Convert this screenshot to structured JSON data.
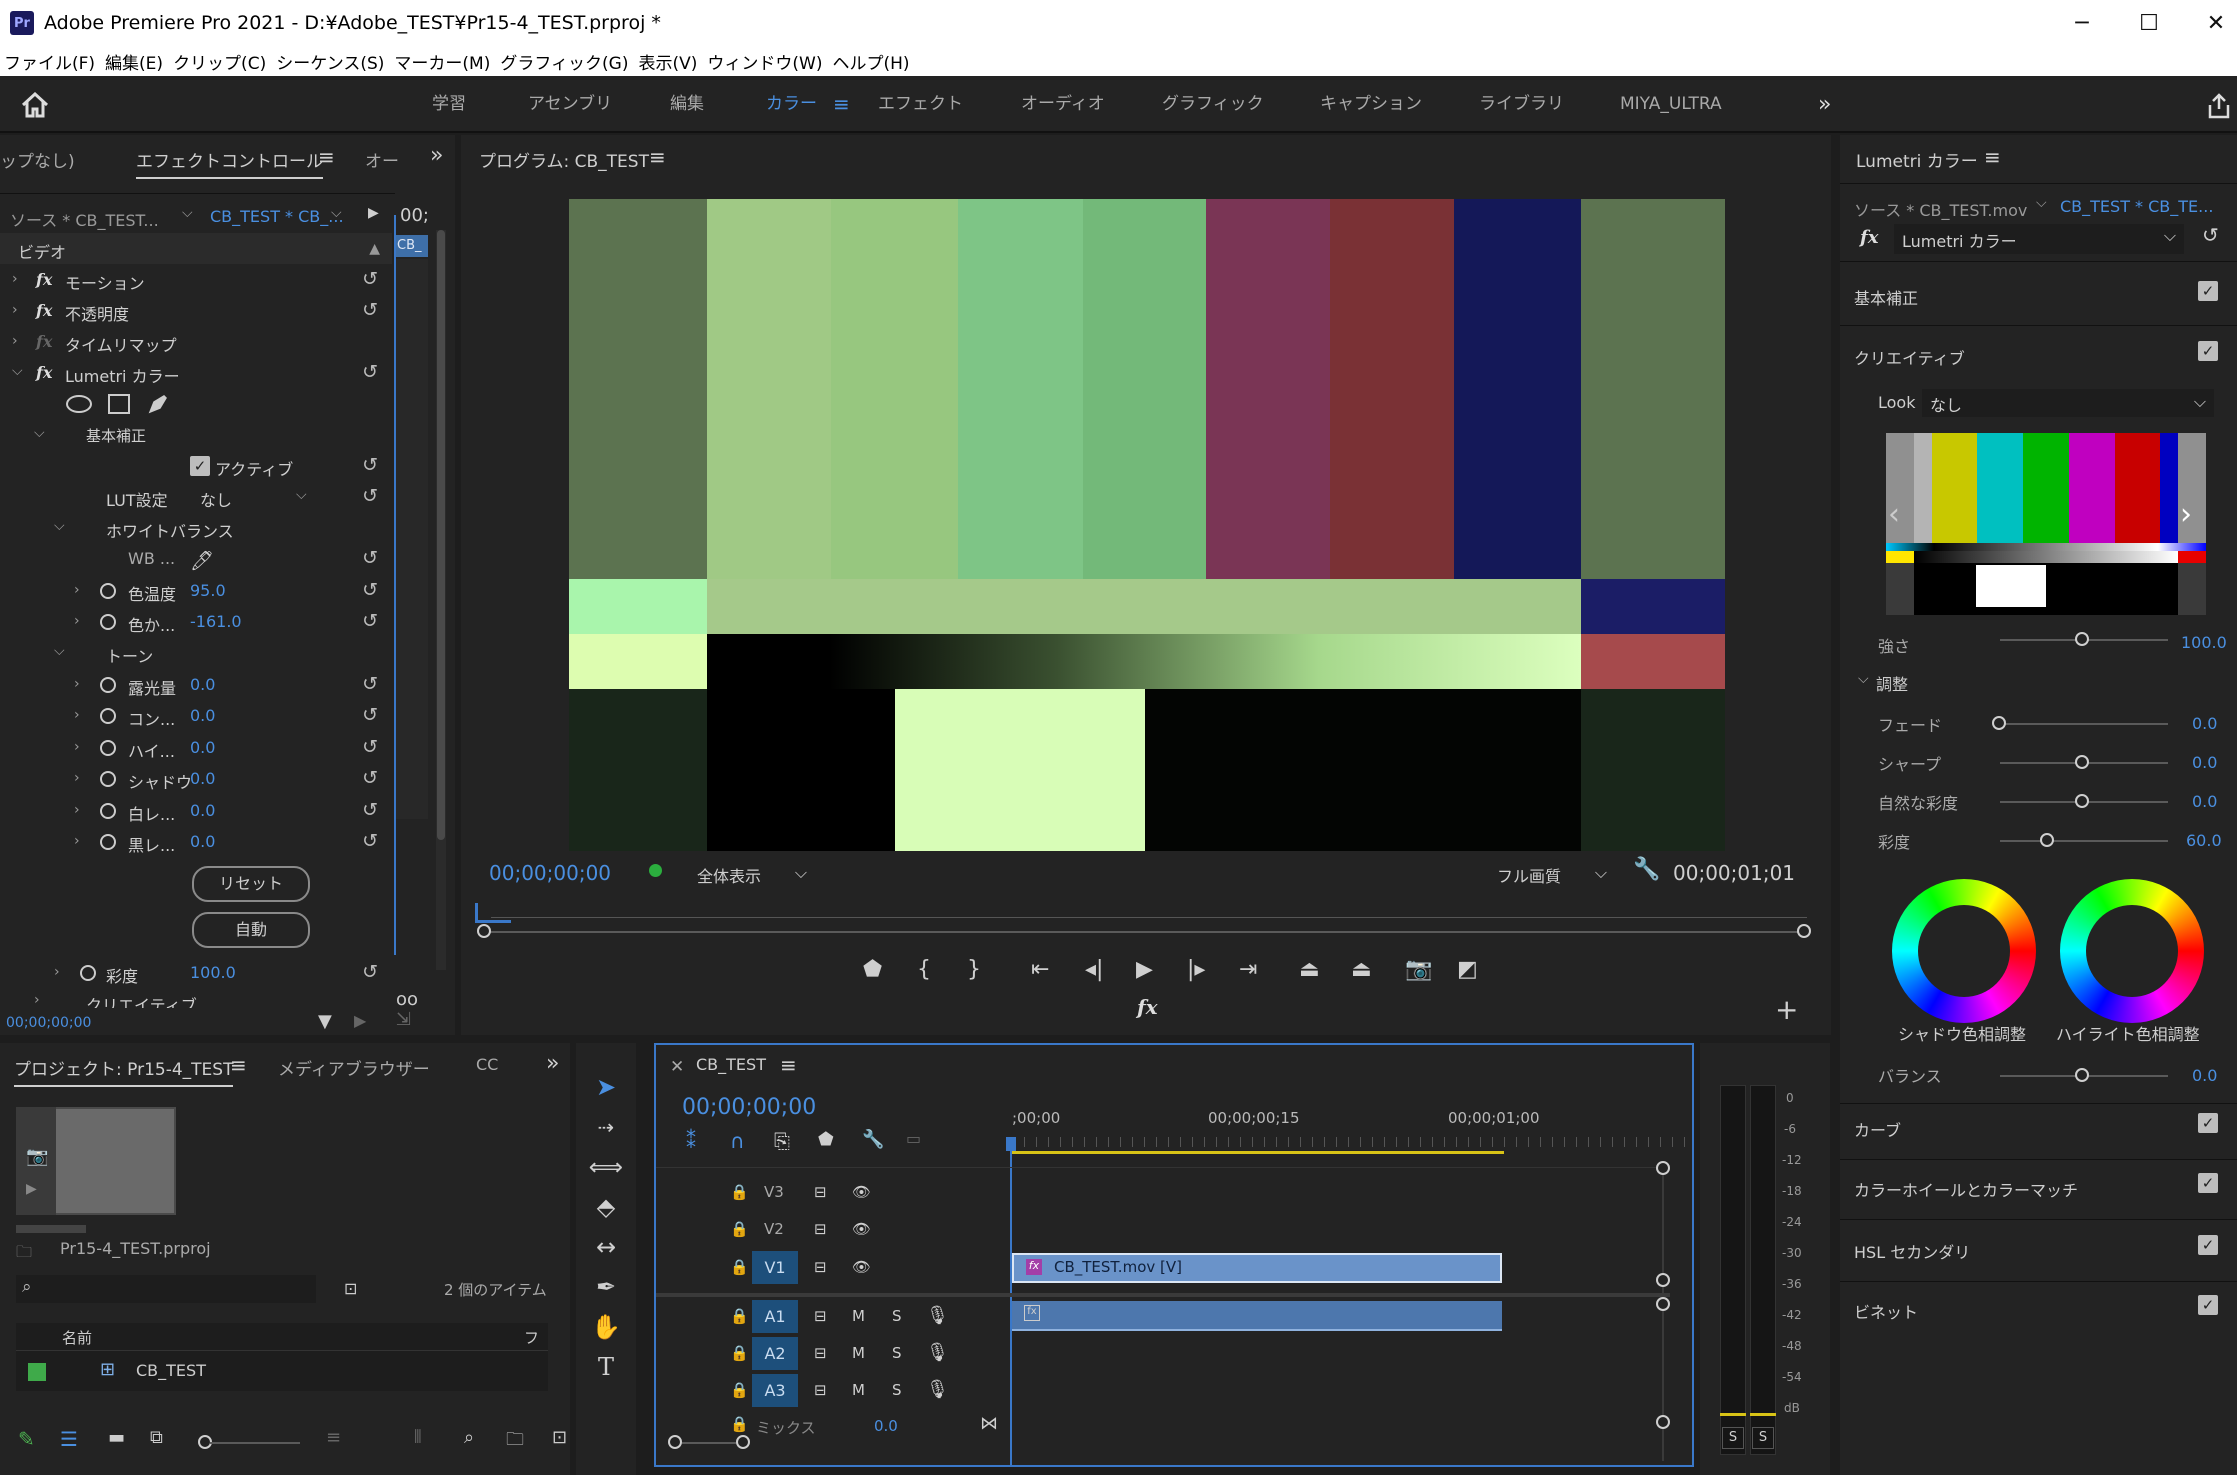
{
  "window": {
    "title": "Adobe Premiere Pro 2021 - D:¥Adobe_TEST¥Pr15-4_TEST.prproj *",
    "app_icon": "Pr",
    "minimize": "─",
    "maximize": "☐",
    "close": "✕"
  },
  "menu": [
    "ファイル(F)",
    "編集(E)",
    "クリップ(C)",
    "シーケンス(S)",
    "マーカー(M)",
    "グラフィック(G)",
    "表示(V)",
    "ウィンドウ(W)",
    "ヘルプ(H)"
  ],
  "workspaces": {
    "learn": "学習",
    "assembly": "アセンブリ",
    "edit": "編集",
    "color": "カラー",
    "effects": "エフェクト",
    "audio": "オーディオ",
    "graphics": "グラフィック",
    "captions": "キャプション",
    "libraries": "ライブラリ",
    "custom": "MIYA_ULTRA"
  },
  "effect_controls": {
    "tab_noclip": "ップなし)",
    "tab_label": "エフェクトコントロール",
    "tab_other": "オー",
    "source": "ソース * CB_TEST...",
    "target": "CB_TEST * CB_...",
    "timecode_cut": "00;",
    "clip_tag": "CB_",
    "video": "ビデオ",
    "motion": "モーション",
    "opacity": "不透明度",
    "time_remap": "タイムリマップ",
    "lumetri": "Lumetri カラー",
    "basic": "基本補正",
    "active": "アクティブ",
    "lut_label": "LUT設定",
    "lut_value": "なし",
    "white_balance": "ホワイトバランス",
    "wb": "WB ...",
    "temp": "色温度",
    "temp_value": "95.0",
    "tint": "色か...",
    "tint_value": "-161.0",
    "tone": "トーン",
    "exposure": "露光量",
    "exposure_value": "0.0",
    "contrast": "コン...",
    "contrast_value": "0.0",
    "highlights": "ハイ...",
    "highlights_value": "0.0",
    "shadows": "シャドウ",
    "shadows_value": "0.0",
    "whites": "白レ...",
    "whites_value": "0.0",
    "blacks": "黒レ...",
    "blacks_value": "0.0",
    "reset_btn": "リセット",
    "auto_btn": "自動",
    "saturation": "彩度",
    "saturation_value": "100.0",
    "creative_cut": "クリエイティブ",
    "bottom_tc": "00;00;00;00"
  },
  "program": {
    "title": "プログラム: CB_TEST",
    "timecode": "00;00;00;00",
    "zoom": "全体表示",
    "quality": "フル画質",
    "duration": "00;00;01;01",
    "fx_icon": "fx"
  },
  "lumetri": {
    "title": "Lumetri カラー",
    "source": "ソース * CB_TEST.mov",
    "target": "CB_TEST * CB_TE...",
    "effect": "Lumetri カラー",
    "basic": "基本補正",
    "creative": "クリエイティブ",
    "look_label": "Look",
    "look_value": "なし",
    "intensity": "強さ",
    "intensity_value": "100.0",
    "adjust": "調整",
    "fade": "フェード",
    "fade_value": "0.0",
    "sharpen": "シャープ",
    "sharpen_value": "0.0",
    "vibrance": "自然な彩度",
    "vibrance_value": "0.0",
    "saturation": "彩度",
    "saturation_value": "60.0",
    "shadow_tint": "シャドウ色相調整",
    "highlight_tint": "ハイライト色相調整",
    "balance": "バランス",
    "balance_value": "0.0",
    "curves": "カーブ",
    "color_wheels": "カラーホイールとカラーマッチ",
    "hsl": "HSL セカンダリ",
    "vignette": "ビネット"
  },
  "project": {
    "tab": "プロジェクト: Pr15-4_TEST",
    "media_browser": "メディアブラウザー",
    "cc": "CC",
    "file": "Pr15-4_TEST.prproj",
    "items": "2 個のアイテム",
    "col_name": "名前",
    "col_f": "フ",
    "item": "CB_TEST"
  },
  "timeline": {
    "tab": "CB_TEST",
    "timecode": "00;00;00;00",
    "ruler": [
      ";00;00",
      "00;00;00;15",
      "00;00;01;00"
    ],
    "tracks": {
      "v3": "V3",
      "v2": "V2",
      "v1": "V1",
      "a1": "A1",
      "a2": "A2",
      "a3": "A3",
      "m": "M",
      "s": "S"
    },
    "clip": "CB_TEST.mov [V]",
    "mix": "ミックス",
    "mix_value": "0.0"
  },
  "meter": {
    "scale": [
      "0",
      "-6",
      "-12",
      "-18",
      "-24",
      "-30",
      "-36",
      "-42",
      "-48",
      "-54",
      "dB"
    ],
    "solo": "S"
  }
}
